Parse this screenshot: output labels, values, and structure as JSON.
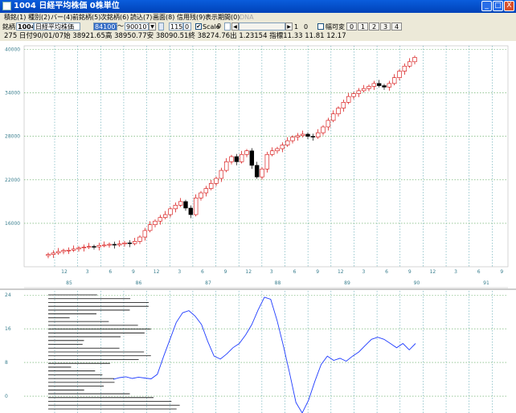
{
  "window": {
    "title": "1004 日経平均株価 0株単位",
    "buttons": {
      "minimize": "_",
      "maximize": "□",
      "close": "X"
    }
  },
  "menu": [
    {
      "label": "積銘(1)",
      "disabled": false
    },
    {
      "label": "種別(2)",
      "disabled": false
    },
    {
      "label": "バー(4)",
      "disabled": false
    },
    {
      "label": "前銘柄(5)",
      "disabled": false
    },
    {
      "label": "次銘柄(6)",
      "disabled": false
    },
    {
      "label": "読込(7)",
      "disabled": false
    },
    {
      "label": "画面(8)",
      "disabled": false
    },
    {
      "label": "信用残(9)",
      "disabled": false
    },
    {
      "label": "表示期間(0)",
      "disabled": false
    },
    {
      "label": "DNA",
      "disabled": true
    }
  ],
  "toolbar": {
    "code_label": "銘柄",
    "code_value": "1004",
    "name_value": "日経平均株価",
    "start_date": "841007",
    "range_sep": "〜",
    "end_date": "900107",
    "count_value": "1150",
    "count_unit": "0",
    "scale_label": "Scale",
    "scale_checked": true,
    "scale_value": "0",
    "step_value": "1",
    "step_unit": "0",
    "width_label": "幅可変",
    "width_checked": false,
    "view_buttons": [
      "0",
      "1",
      "2",
      "3",
      "4"
    ]
  },
  "info_line": "275 日付90/01/07始 38921.65高 38950.77安 38090.51終 38274.76出 1.23154 指標11.33  11.81  12.17",
  "chart_data": {
    "type": "candlestick",
    "series_description": "monthly-spaced candlesticks",
    "y_ticks": [
      "40000",
      "34000",
      "28000",
      "22000",
      "16000"
    ],
    "ylim": [
      10000,
      40500
    ],
    "x_month_labels": [
      "12",
      "3",
      "6",
      "9",
      "12",
      "3",
      "6",
      "9",
      "12",
      "3",
      "6",
      "9",
      "12",
      "3",
      "6",
      "9",
      "12",
      "3",
      "6",
      "9",
      "12",
      "3",
      "6",
      "9",
      "12",
      "3"
    ],
    "x_year_labels": [
      "85",
      "86",
      "87",
      "88",
      "89",
      "90",
      "91"
    ],
    "price_close": [
      11700,
      11900,
      12100,
      12250,
      12300,
      12450,
      12600,
      12700,
      12800,
      12750,
      12950,
      13000,
      13100,
      13000,
      13150,
      13300,
      13200,
      13500,
      14100,
      15000,
      15800,
      16300,
      16800,
      17200,
      18000,
      18500,
      19000,
      18100,
      17200,
      19500,
      20200,
      20800,
      21500,
      22200,
      23300,
      24500,
      25200,
      24500,
      25500,
      26000,
      24000,
      22400,
      23500,
      25500,
      26000,
      26300,
      26800,
      27400,
      27900,
      28100,
      28300,
      28000,
      27900,
      28500,
      29300,
      30200,
      31100,
      31900,
      32700,
      33500,
      33900,
      34300,
      34600,
      34900,
      35300,
      35000,
      34800,
      35300,
      36100,
      37000,
      37700,
      38300,
      38900
    ],
    "indicator": {
      "name": "",
      "y_ticks": [
        "24",
        "16",
        "8",
        "0"
      ],
      "ylim": [
        -4,
        25
      ],
      "values": [
        4.0,
        4.4,
        4.6,
        4.2,
        4.5,
        4.3,
        4.1,
        5.2,
        9.5,
        13.5,
        17.5,
        19.8,
        20.3,
        19.0,
        17.0,
        13.0,
        9.5,
        8.8,
        10.0,
        11.5,
        12.5,
        14.5,
        17.0,
        20.5,
        23.5,
        23.0,
        18.0,
        12.0,
        5.5,
        -1.5,
        -4.0,
        -1.0,
        3.5,
        7.5,
        9.5,
        8.5,
        9.0,
        8.3,
        9.5,
        10.5,
        12.0,
        13.5,
        14.0,
        13.5,
        12.5,
        11.5,
        12.5,
        11.0,
        12.5
      ],
      "volume_profile_rows": 31
    }
  }
}
